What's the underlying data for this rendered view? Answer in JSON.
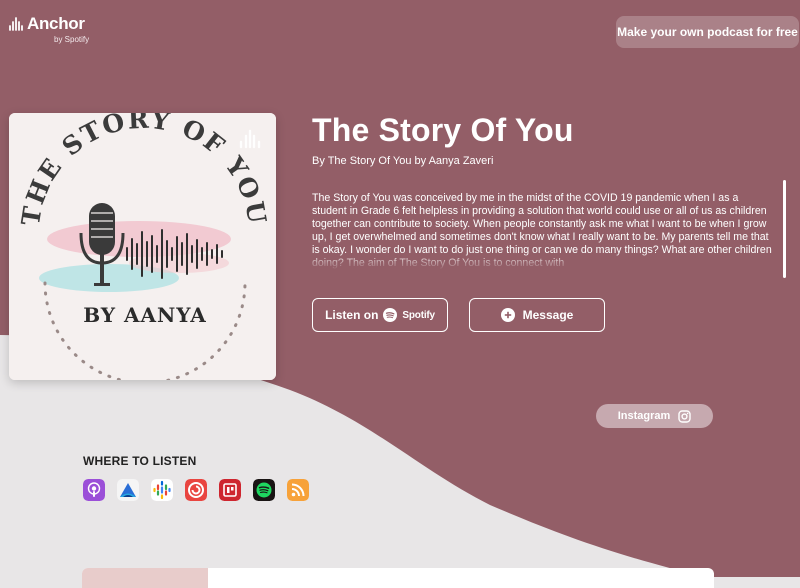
{
  "colors": {
    "brand": "#935e67",
    "page_bg": "#e8e6e7"
  },
  "header": {
    "logo_text": "Anchor",
    "logo_sub": "by Spotify",
    "cta_label": "Make your own podcast for free"
  },
  "podcast": {
    "cover_art": {
      "title_text": "THE STORY OF YOU",
      "byline_text": "BY AANYA"
    },
    "title": "The Story Of You",
    "author": "By The Story Of You by Aanya Zaveri",
    "description": "The Story of You was conceived by me in the midst of the COVID 19 pandemic when I as a student in Grade 6 felt helpless in providing a solution that world could use or all of us as children together can contribute to society. When people constantly ask me what I want to be when I grow up, I get overwhelmed and sometimes don't know what I really want to be. My parents tell me that is okay. I wonder do I want to do just one thing or can we do many things? What are other children doing? The aim of The Story Of You is to connect with"
  },
  "actions": {
    "listen_prefix": "Listen on",
    "listen_platform": "Spotify",
    "message_label": "Message",
    "instagram_label": "Instagram"
  },
  "where_to_listen": {
    "heading": "WHERE TO LISTEN",
    "platforms": [
      {
        "name": "Apple Podcasts",
        "icon": "apple-podcasts-icon",
        "color": "#9b4fd8"
      },
      {
        "name": "Castbox",
        "icon": "castbox-icon",
        "color": "#f5f5f5"
      },
      {
        "name": "Google Podcasts",
        "icon": "google-podcasts-icon",
        "color": "#ffffff"
      },
      {
        "name": "Pocket Casts",
        "icon": "pocket-casts-icon",
        "color": "#e94540"
      },
      {
        "name": "RadioPublic",
        "icon": "radiopublic-icon",
        "color": "#ce262f"
      },
      {
        "name": "Spotify",
        "icon": "spotify-icon",
        "color": "#1ed760"
      },
      {
        "name": "RSS",
        "icon": "rss-icon",
        "color": "#f7a23a"
      }
    ]
  }
}
